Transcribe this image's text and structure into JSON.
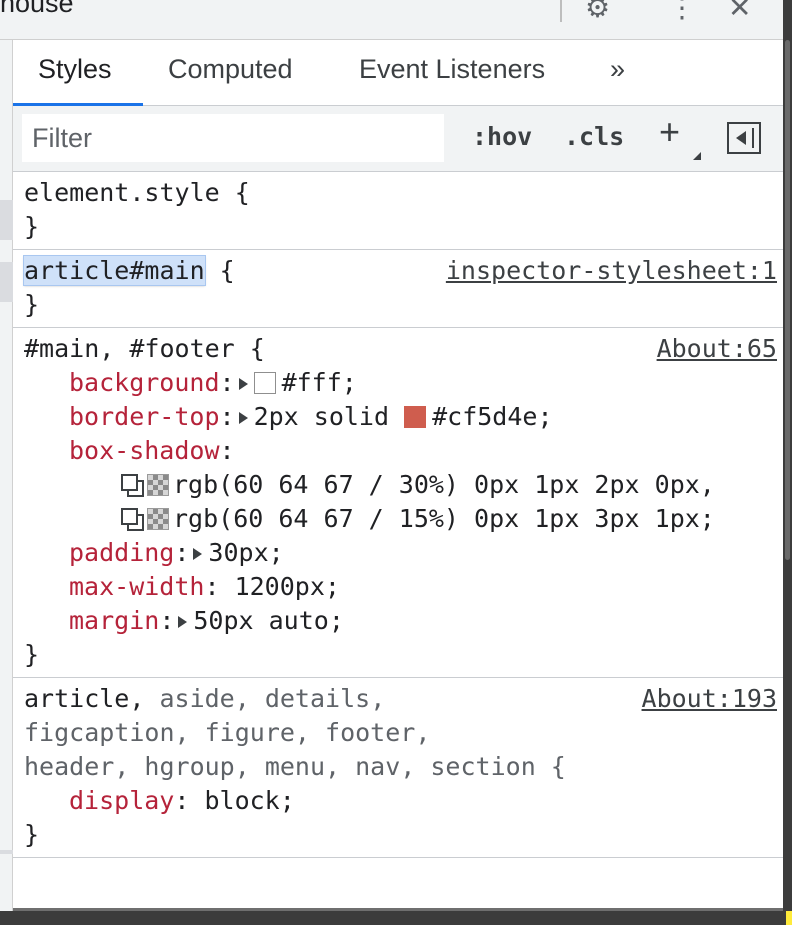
{
  "window": {
    "title": "house",
    "icons": [
      "gear-icon",
      "more-vertical-icon",
      "close-icon"
    ]
  },
  "tabs": [
    {
      "label": "Styles",
      "active": true
    },
    {
      "label": "Computed",
      "active": false
    },
    {
      "label": "Event Listeners",
      "active": false
    },
    {
      "label": "»",
      "active": false
    }
  ],
  "toolbar": {
    "filter_placeholder": "Filter",
    "hov_label": ":hov",
    "cls_label": ".cls",
    "new_rule_label": "+"
  },
  "rules": {
    "element_style": {
      "selector": "element.style {",
      "close": "}"
    },
    "article_main": {
      "selector": "article#main",
      "open": " {",
      "close": "}",
      "source": "inspector-stylesheet:1"
    },
    "main_footer": {
      "selector": "#main, #footer",
      "open": " {",
      "close": "}",
      "source": "About:65",
      "background_name": "background",
      "background_value": "#fff;",
      "background_color": "#ffffff",
      "border_top_name": "border-top",
      "border_top_value_pre": "2px solid ",
      "border_top_value_color": "#cf5d4e;",
      "border_top_color": "#cf5d4e",
      "box_shadow_name": "box-shadow",
      "box_shadow_value_1": "rgb(60 64 67 / 30%) 0px 1px 2px 0px,",
      "box_shadow_value_2": "rgb(60 64 67 / 15%) 0px 1px 3px 1px;",
      "padding_name": "padding",
      "padding_value": "30px;",
      "max_width_name": "max-width",
      "max_width_value": "1200px;",
      "margin_name": "margin",
      "margin_value": "50px auto;"
    },
    "article_group": {
      "selector_match": "article,",
      "selector_rest_line1": " aside, details,",
      "selector_line2": "figcaption, figure, footer,",
      "selector_line3": "header, hgroup, menu, nav, section {",
      "source": "About:193",
      "display_name": "display",
      "display_value": "block;",
      "close": "}"
    }
  }
}
